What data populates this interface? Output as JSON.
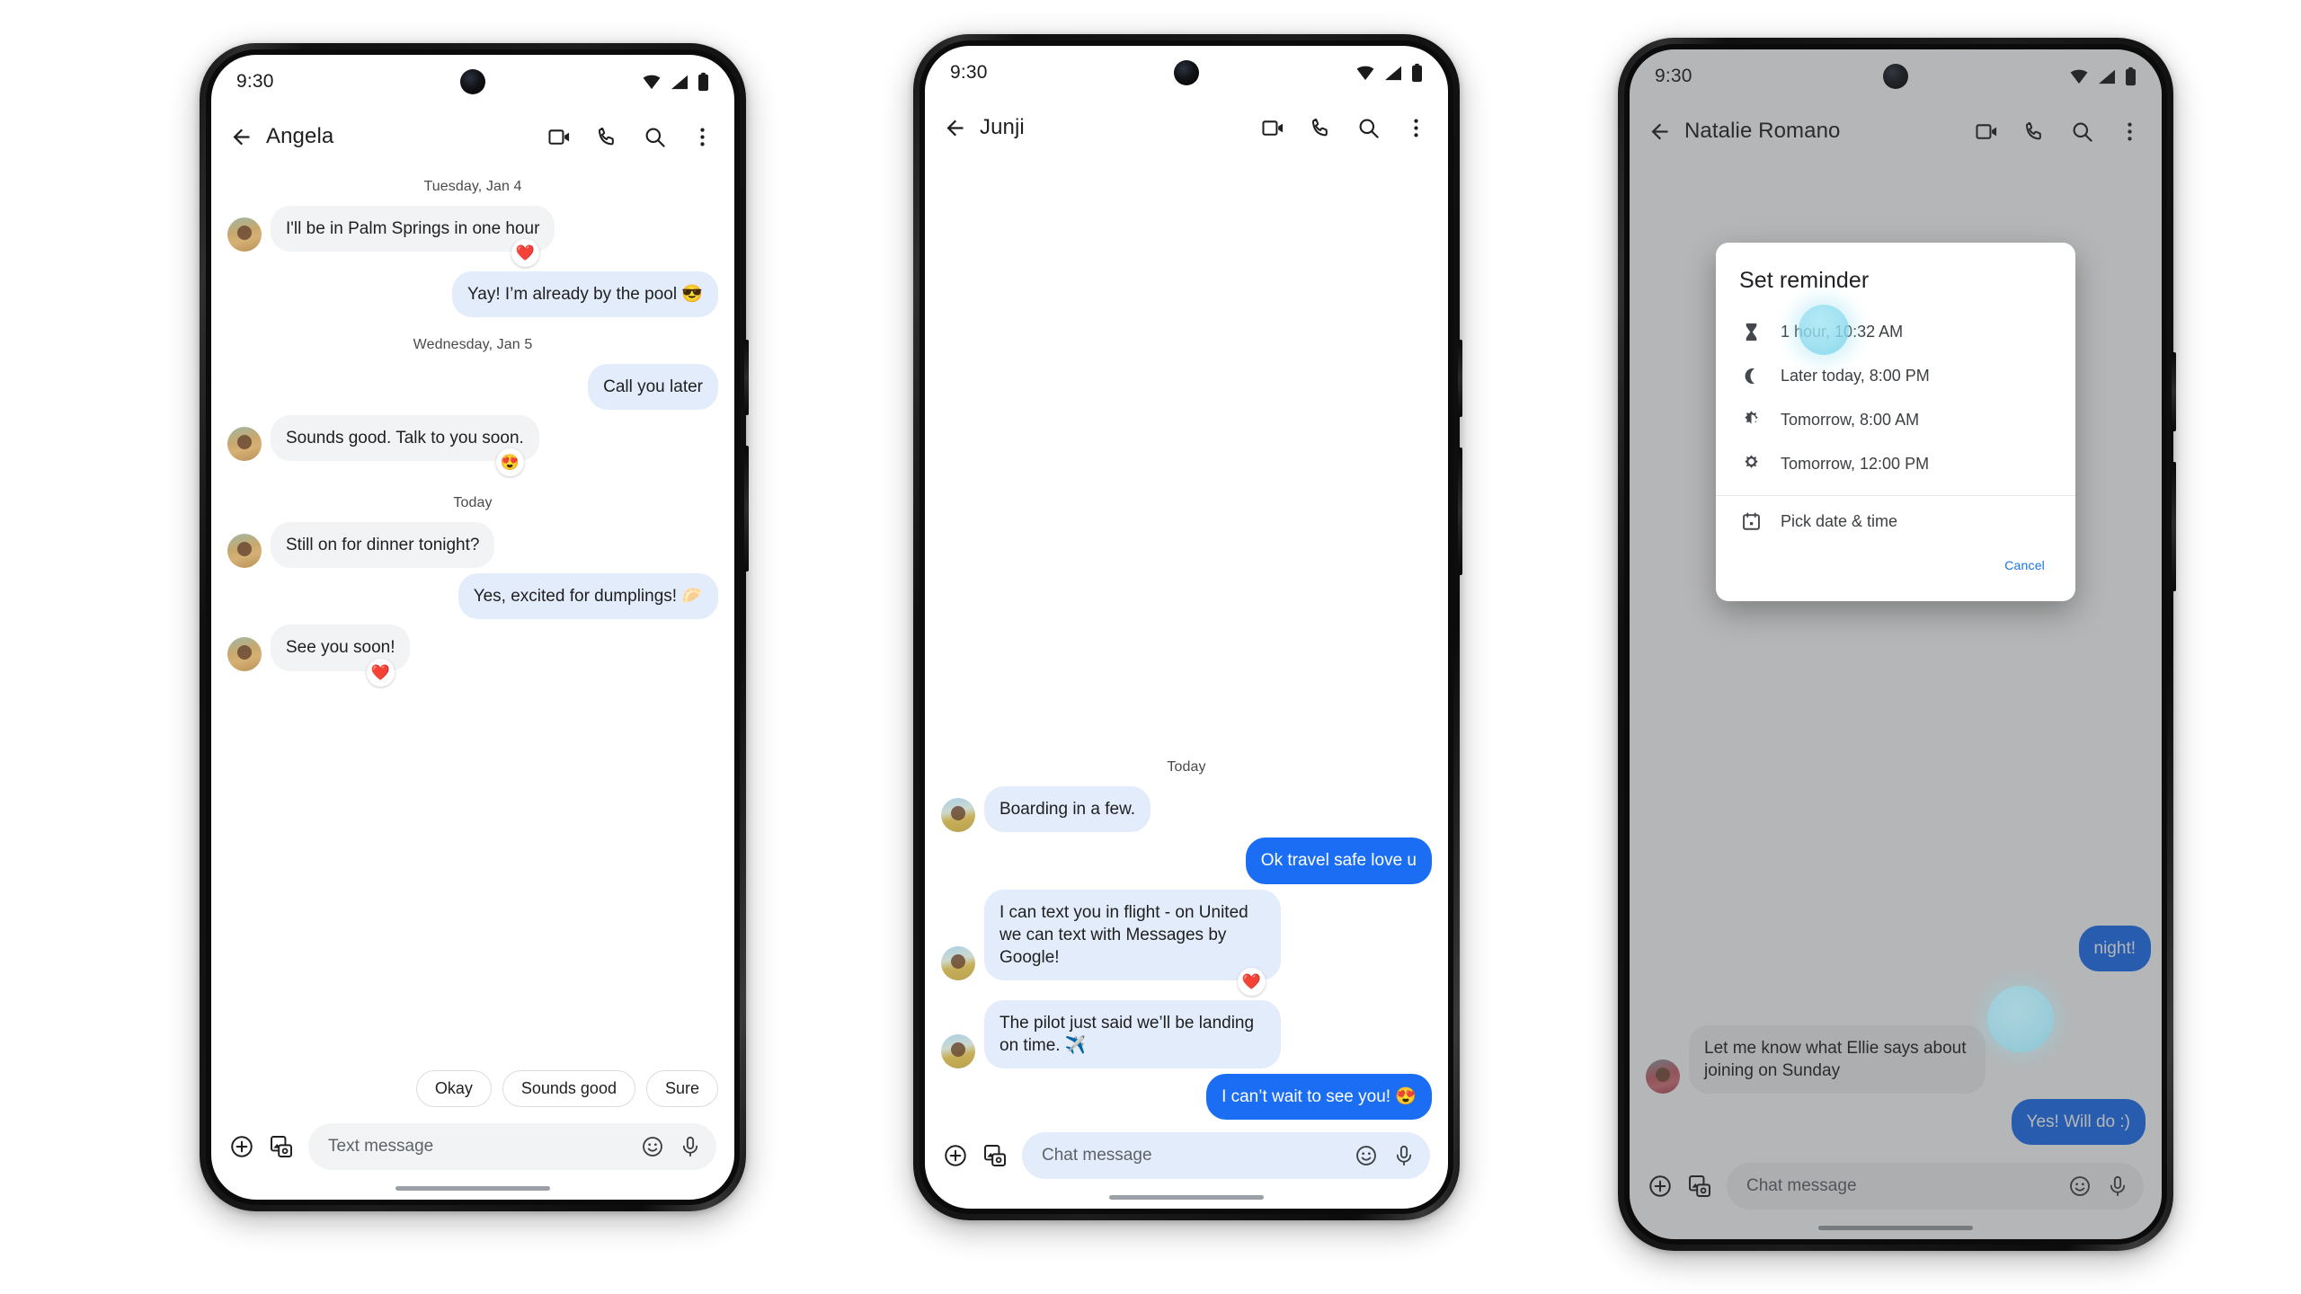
{
  "meta": {
    "accent_blue": "#1b6ef3",
    "bubble_gray": "#f1f3f4",
    "bubble_light_blue": "#e3ecfb",
    "link_blue": "#1a73e8",
    "touch_indicator_color": "#8ddcef"
  },
  "status_bar": {
    "time": "9:30",
    "icons": [
      "wifi-icon",
      "cellular-signal-icon",
      "battery-icon"
    ]
  },
  "appbar_actions": [
    "video-call-icon",
    "phone-call-icon",
    "search-icon",
    "more-options-icon"
  ],
  "phones": [
    {
      "id": "phone-angela",
      "title": "Angela",
      "bubble_incoming_style": "gray",
      "bubble_outgoing_style": "lblue",
      "compose_style": "gray",
      "compose_placeholder": "Text message",
      "has_chips": true,
      "chips": [
        "Okay",
        "Sounds good",
        "Sure"
      ],
      "thread": [
        {
          "kind": "daysep",
          "text": "Tuesday, Jan 4"
        },
        {
          "kind": "msg",
          "side": "in",
          "text": "I'll be in Palm Springs in one hour",
          "reaction": "❤️"
        },
        {
          "kind": "msg",
          "side": "out",
          "text": "Yay! I’m already by the pool 😎"
        },
        {
          "kind": "daysep",
          "text": "Wednesday, Jan 5"
        },
        {
          "kind": "msg",
          "side": "out",
          "text": "Call you later"
        },
        {
          "kind": "msg",
          "side": "in",
          "text": "Sounds good. Talk to you soon.",
          "reaction": "😍"
        },
        {
          "kind": "daysep",
          "text": "Today"
        },
        {
          "kind": "msg",
          "side": "in",
          "text": "Still on for dinner tonight?"
        },
        {
          "kind": "msg",
          "side": "out",
          "text": "Yes, excited for dumplings! 🥟"
        },
        {
          "kind": "msg",
          "side": "in",
          "text": "See you soon!",
          "reaction": "❤️"
        }
      ]
    },
    {
      "id": "phone-junji",
      "title": "Junji",
      "bubble_incoming_style": "lblue",
      "bubble_outgoing_style": "blue",
      "compose_style": "lblue",
      "compose_placeholder": "Chat message",
      "has_chips": false,
      "chips": [],
      "thread": [
        {
          "kind": "daysep",
          "text": "Today"
        },
        {
          "kind": "msg",
          "side": "in",
          "text": "Boarding in a few."
        },
        {
          "kind": "msg",
          "side": "out",
          "text": "Ok travel safe love u"
        },
        {
          "kind": "msg",
          "side": "in",
          "text": "I can text you in flight - on United we can text with Messages by Google!",
          "reaction": "❤️"
        },
        {
          "kind": "msg",
          "side": "in",
          "text": "The pilot just said we’ll be landing on time. ✈️"
        },
        {
          "kind": "msg",
          "side": "out",
          "text": "I can’t wait to see you! 😍"
        }
      ]
    },
    {
      "id": "phone-natalie",
      "title": "Natalie Romano",
      "bubble_incoming_style": "gray",
      "bubble_outgoing_style": "blue",
      "compose_style": "gray",
      "compose_placeholder": "Chat message",
      "has_chips": false,
      "chips": [],
      "dimmed": true,
      "thread": [
        {
          "kind": "msg",
          "side": "out",
          "text": "night!"
        },
        {
          "kind": "msg",
          "side": "in",
          "text": "Let me know what Ellie says about joining on Sunday"
        },
        {
          "kind": "msg",
          "side": "out",
          "text": "Yes! Will do :)"
        }
      ],
      "dialog": {
        "title": "Set reminder",
        "options": [
          {
            "icon": "hourglass-icon",
            "label": "1 hour, 10:32 AM"
          },
          {
            "icon": "moon-icon",
            "label": "Later today, 8:00 PM"
          },
          {
            "icon": "sunrise-icon",
            "label": "Tomorrow, 8:00 AM"
          },
          {
            "icon": "sun-icon",
            "label": "Tomorrow, 12:00 PM"
          }
        ],
        "picker": {
          "icon": "calendar-icon",
          "label": "Pick date & time"
        },
        "cancel_label": "Cancel"
      }
    }
  ]
}
